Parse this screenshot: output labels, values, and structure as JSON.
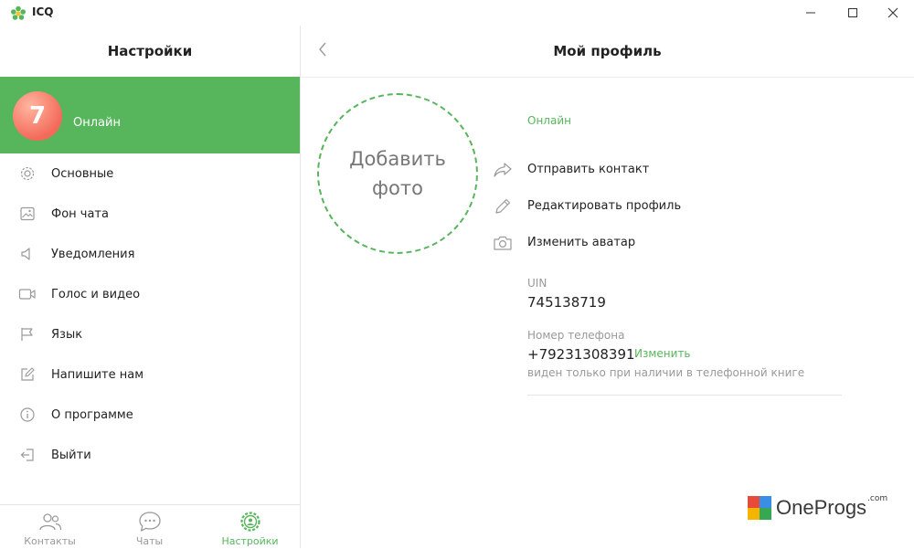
{
  "window": {
    "app_title": "ICQ",
    "minimize_glyph": "—",
    "maximize_glyph": "☐",
    "close_glyph": "✕"
  },
  "sidebar": {
    "title": "Настройки",
    "profile": {
      "avatar_text": "7",
      "status": "Онлайн"
    },
    "items": [
      {
        "label": "Основные",
        "icon": "gear-icon"
      },
      {
        "label": "Фон чата",
        "icon": "image-icon"
      },
      {
        "label": "Уведомления",
        "icon": "speaker-icon"
      },
      {
        "label": "Голос и видео",
        "icon": "video-camera-icon"
      },
      {
        "label": "Язык",
        "icon": "flag-icon"
      },
      {
        "label": "Напишите нам",
        "icon": "edit-icon"
      },
      {
        "label": "О программе",
        "icon": "info-icon"
      },
      {
        "label": "Выйти",
        "icon": "logout-icon"
      }
    ]
  },
  "tabs": [
    {
      "label": "Контакты",
      "icon": "contacts-icon",
      "active": false
    },
    {
      "label": "Чаты",
      "icon": "chat-bubble-icon",
      "active": false
    },
    {
      "label": "Настройки",
      "icon": "settings-icon",
      "active": true
    }
  ],
  "main": {
    "title": "Мой профиль",
    "add_photo": "Добавить фото",
    "status": "Онлайн",
    "actions": [
      {
        "label": "Отправить контакт",
        "icon": "share-icon"
      },
      {
        "label": "Редактировать профиль",
        "icon": "pencil-icon"
      },
      {
        "label": "Изменить аватар",
        "icon": "camera-icon"
      }
    ],
    "uin_label": "UIN",
    "uin_value": "745138719",
    "phone_label": "Номер телефона",
    "phone_value": "+79231308391",
    "phone_change": "Изменить",
    "phone_note": "виден только при наличии в телефонной книге"
  },
  "watermark": {
    "text": "OneProgs",
    "suffix": ".com"
  },
  "colors": {
    "accent": "#57b55c",
    "icon_gray": "#9a9a9a"
  }
}
